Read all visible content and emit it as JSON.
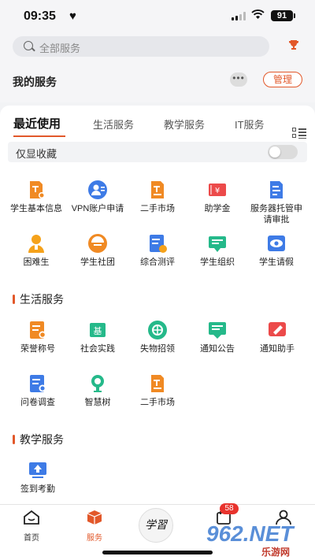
{
  "status": {
    "time": "09:35",
    "battery": "91"
  },
  "search": {
    "placeholder": "全部服务"
  },
  "my_services": {
    "title": "我的服务",
    "more_label": "•••",
    "manage_label": "管理"
  },
  "tabs": [
    {
      "label": "最近使用",
      "active": true
    },
    {
      "label": "生活服务",
      "active": false
    },
    {
      "label": "教学服务",
      "active": false
    },
    {
      "label": "IT服务",
      "active": false
    }
  ],
  "favorites_toggle": {
    "label": "仅显收藏",
    "on": false
  },
  "recent_apps": [
    {
      "label": "学生基本信息",
      "icon": "student-info-icon",
      "color": "#f08a24"
    },
    {
      "label": "VPN账户申请",
      "icon": "vpn-account-icon",
      "color": "#3e7be6"
    },
    {
      "label": "二手市场",
      "icon": "second-hand-market-icon",
      "color": "#f08a24"
    },
    {
      "label": "助学金",
      "icon": "grant-icon",
      "color": "#ec4a4a"
    },
    {
      "label": "服务器托管申请审批",
      "icon": "server-hosting-icon",
      "color": "#3e7be6"
    },
    {
      "label": "困难生",
      "icon": "needy-student-icon",
      "color": "#f5a21b"
    },
    {
      "label": "学生社团",
      "icon": "student-club-icon",
      "color": "#f08a24"
    },
    {
      "label": "综合测评",
      "icon": "comprehensive-evaluation-icon",
      "color": "#3e7be6"
    },
    {
      "label": "学生组织",
      "icon": "student-organization-icon",
      "color": "#25b98a"
    },
    {
      "label": "学生请假",
      "icon": "student-leave-icon",
      "color": "#3e7be6"
    }
  ],
  "life_section": {
    "title": "生活服务",
    "apps": [
      {
        "label": "荣誉称号",
        "icon": "honor-title-icon",
        "color": "#f08a24"
      },
      {
        "label": "社会实践",
        "icon": "social-practice-icon",
        "color": "#25b98a"
      },
      {
        "label": "失物招领",
        "icon": "lost-found-icon",
        "color": "#25b98a"
      },
      {
        "label": "通知公告",
        "icon": "notice-icon",
        "color": "#25b98a"
      },
      {
        "label": "通知助手",
        "icon": "notice-assistant-icon",
        "color": "#ec4a4a"
      },
      {
        "label": "问卷调查",
        "icon": "questionnaire-icon",
        "color": "#3e7be6"
      },
      {
        "label": "智慧树",
        "icon": "smart-tree-icon",
        "color": "#25b98a"
      },
      {
        "label": "二手市场",
        "icon": "second-hand-market-icon",
        "color": "#f08a24"
      }
    ]
  },
  "teaching_section": {
    "title": "教学服务",
    "apps": [
      {
        "label": "签到考勤",
        "icon": "attendance-icon",
        "color": "#3e7be6"
      }
    ]
  },
  "tabbar": {
    "home": "首页",
    "services": "服务",
    "center": "学習",
    "badge": "58"
  },
  "watermark": {
    "main": "962.NET",
    "sub": "乐游网"
  },
  "colors": {
    "accent": "#e2582a",
    "orange": "#f08a24",
    "blue": "#3e7be6",
    "green": "#25b98a",
    "red": "#ec4a4a"
  }
}
